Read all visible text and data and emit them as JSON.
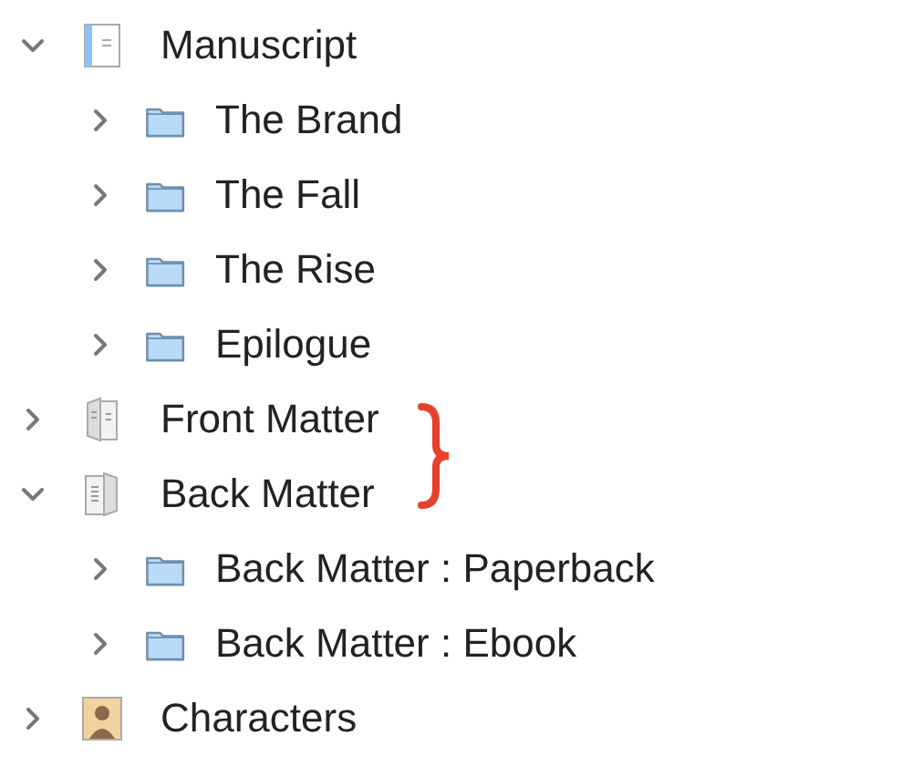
{
  "binder": {
    "items": [
      {
        "label": "Manuscript",
        "kind": "manuscript",
        "expanded": true,
        "children": [
          {
            "label": "The Brand",
            "kind": "folder",
            "expanded": false
          },
          {
            "label": "The Fall",
            "kind": "folder",
            "expanded": false
          },
          {
            "label": "The Rise",
            "kind": "folder",
            "expanded": false
          },
          {
            "label": "Epilogue",
            "kind": "folder",
            "expanded": false
          }
        ]
      },
      {
        "label": "Front Matter",
        "kind": "front-matter",
        "expanded": false
      },
      {
        "label": "Back Matter",
        "kind": "back-matter",
        "expanded": true,
        "children": [
          {
            "label": "Back Matter : Paperback",
            "kind": "folder",
            "expanded": false
          },
          {
            "label": "Back Matter : Ebook",
            "kind": "folder",
            "expanded": false
          }
        ]
      },
      {
        "label": "Characters",
        "kind": "characters",
        "expanded": false
      }
    ]
  }
}
